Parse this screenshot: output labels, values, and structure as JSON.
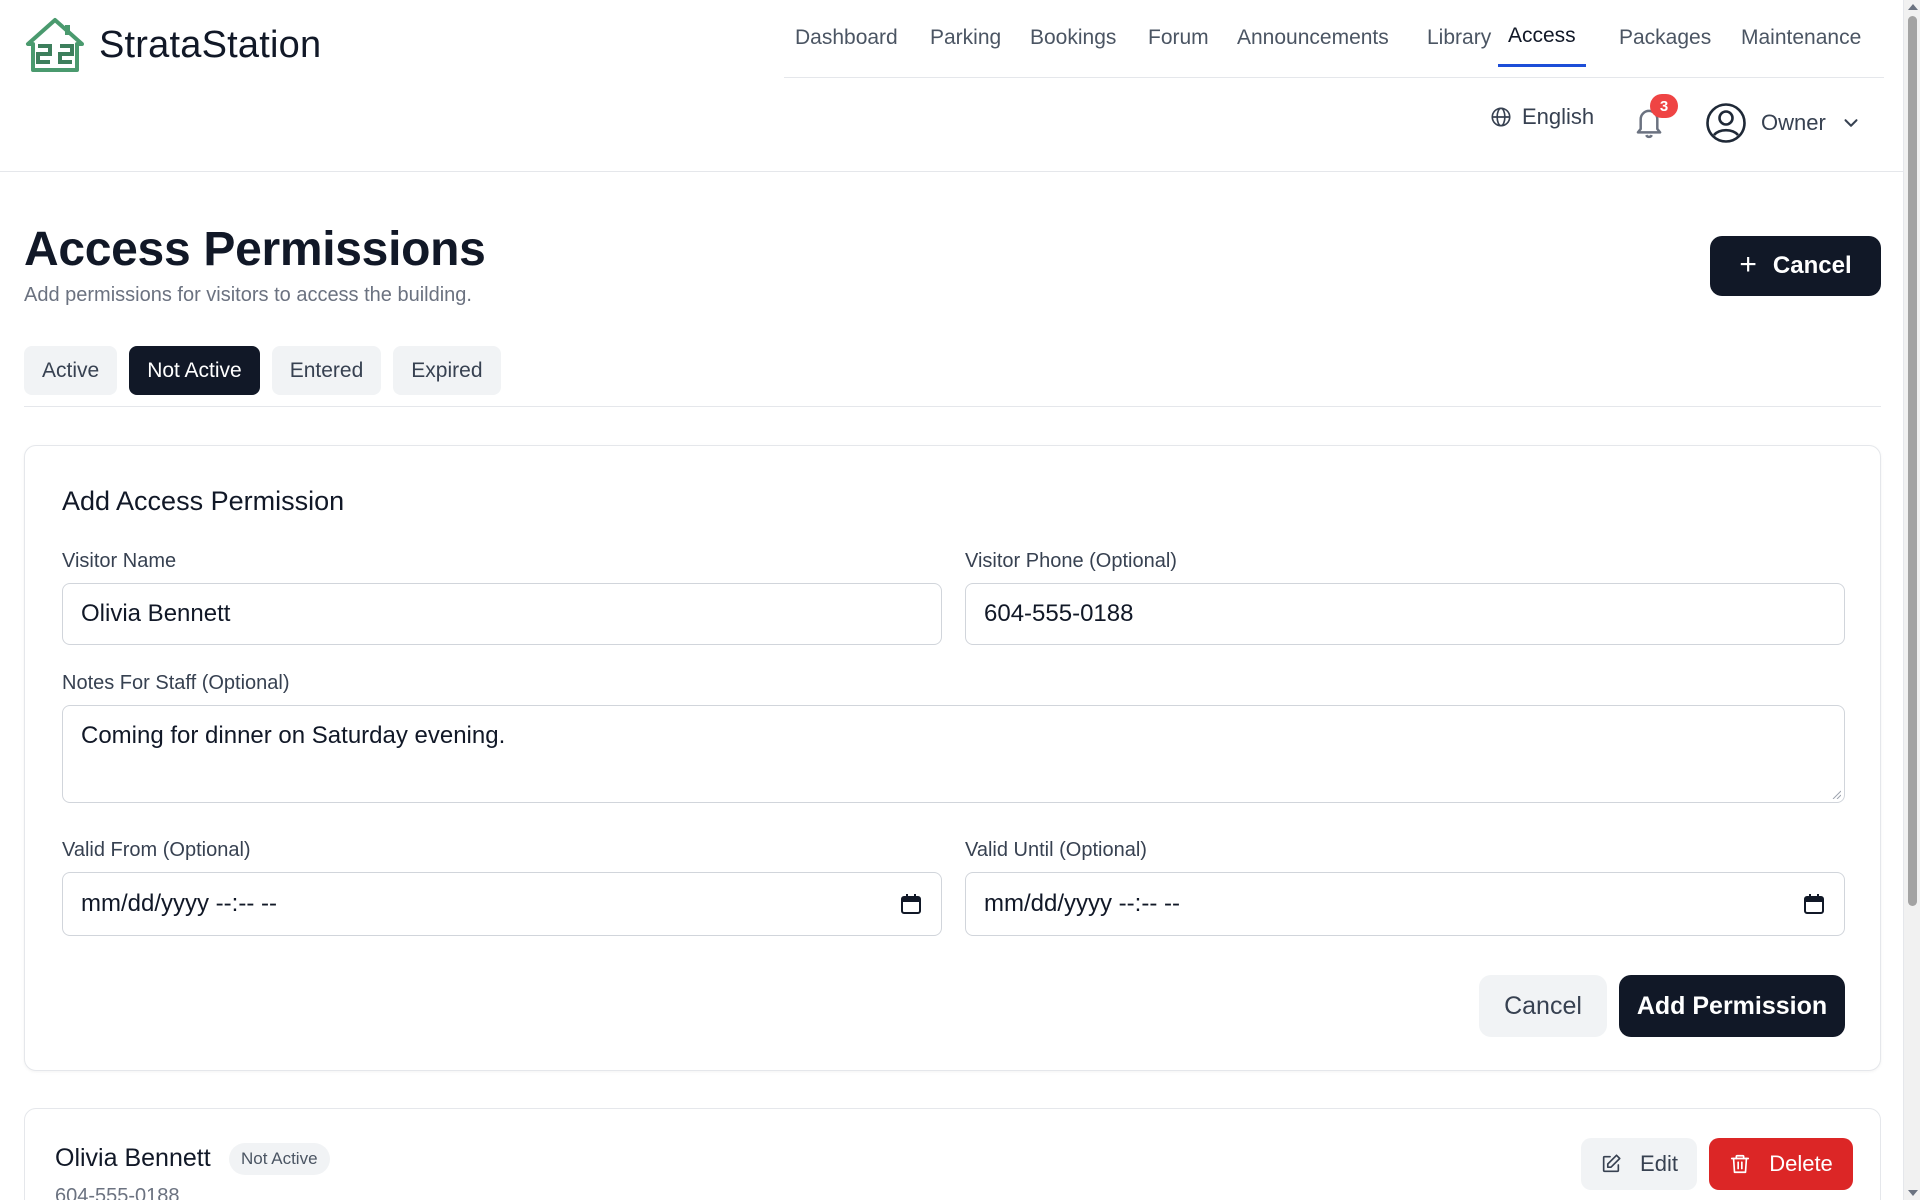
{
  "app": {
    "name": "StrataStation"
  },
  "nav": {
    "items": [
      {
        "label": "Dashboard"
      },
      {
        "label": "Parking"
      },
      {
        "label": "Bookings"
      },
      {
        "label": "Forum"
      },
      {
        "label": "Announcements"
      },
      {
        "label": "Library"
      },
      {
        "label": "Access"
      },
      {
        "label": "Packages"
      },
      {
        "label": "Maintenance"
      }
    ],
    "active": "Access"
  },
  "utility": {
    "language": "English",
    "notifications_count": "3",
    "user_role": "Owner"
  },
  "page": {
    "title": "Access Permissions",
    "subtitle": "Add permissions for visitors to access the building.",
    "toggle_button_label": "Cancel"
  },
  "tabs": [
    {
      "label": "Active"
    },
    {
      "label": "Not Active"
    },
    {
      "label": "Entered"
    },
    {
      "label": "Expired"
    }
  ],
  "tabs_active": "Not Active",
  "form": {
    "title": "Add Access Permission",
    "visitor_name_label": "Visitor Name",
    "visitor_name_value": "Olivia Bennett",
    "visitor_phone_label": "Visitor Phone (Optional)",
    "visitor_phone_value": "604-555-0188",
    "notes_label": "Notes For Staff (Optional)",
    "notes_value": "Coming for dinner on Saturday evening.",
    "valid_from_label": "Valid From (Optional)",
    "valid_from_placeholder": "mm/dd/yyyy --:-- --",
    "valid_until_label": "Valid Until (Optional)",
    "valid_until_placeholder": "mm/dd/yyyy --:-- --",
    "cancel_label": "Cancel",
    "submit_label": "Add Permission"
  },
  "permissions": [
    {
      "name": "Olivia Bennett",
      "status": "Not Active",
      "phone": "604-555-0188",
      "edit_label": "Edit",
      "delete_label": "Delete"
    }
  ],
  "colors": {
    "primary": "#111827",
    "accent_underline": "#1d4ed8",
    "danger": "#dc2626",
    "badge": "#ef4444",
    "logo_green": "#4a9a6e"
  }
}
